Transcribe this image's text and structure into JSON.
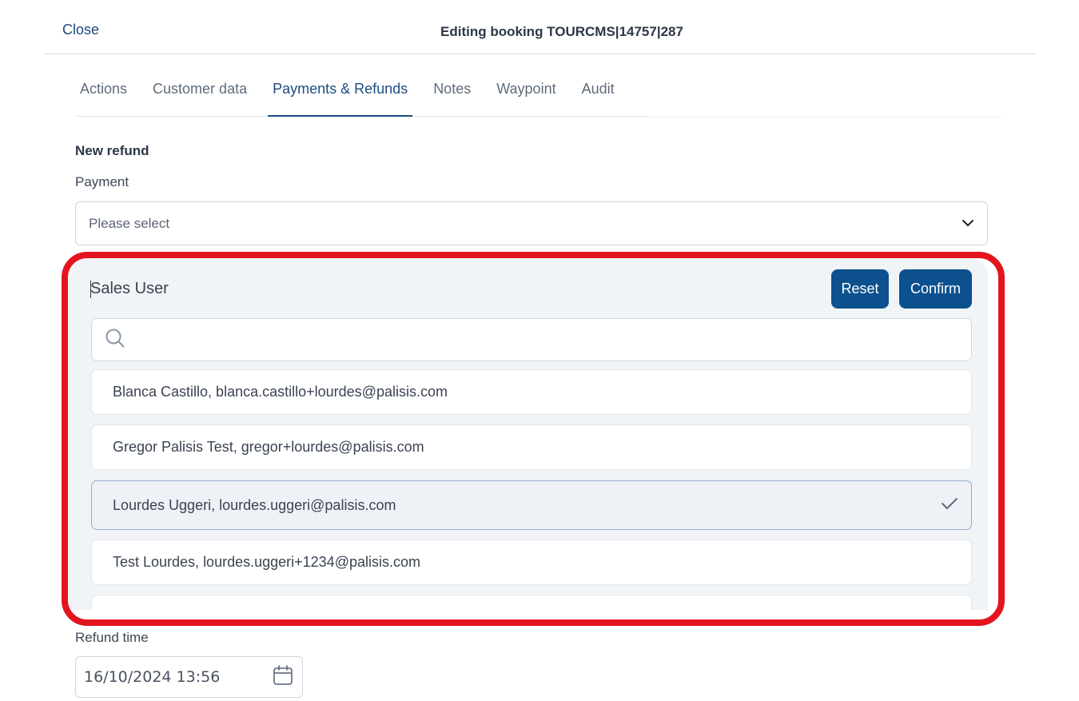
{
  "header": {
    "close_label": "Close",
    "title": "Editing booking TOURCMS|14757|287"
  },
  "tabs": [
    {
      "label": "Actions",
      "active": false
    },
    {
      "label": "Customer data",
      "active": false
    },
    {
      "label": "Payments & Refunds",
      "active": true
    },
    {
      "label": "Notes",
      "active": false
    },
    {
      "label": "Waypoint",
      "active": false
    },
    {
      "label": "Audit",
      "active": false
    }
  ],
  "refund": {
    "section_title": "New refund",
    "payment_label": "Payment",
    "payment_placeholder": "Please select",
    "refund_time_label": "Refund time",
    "refund_time_value": "16/10/2024 13:56"
  },
  "sales_user": {
    "title": "Sales User",
    "reset_label": "Reset",
    "confirm_label": "Confirm",
    "search_value": "",
    "options": [
      {
        "label": "Blanca Castillo, blanca.castillo+lourdes@palisis.com",
        "selected": false
      },
      {
        "label": "Gregor Palisis Test, gregor+lourdes@palisis.com",
        "selected": false
      },
      {
        "label": "Lourdes Uggeri, lourdes.uggeri@palisis.com",
        "selected": true
      },
      {
        "label": "Test Lourdes, lourdes.uggeri+1234@palisis.com",
        "selected": false
      }
    ]
  },
  "colors": {
    "accent": "#0d508e",
    "highlight": "#e3141d"
  },
  "icons": {
    "dropdown": "chevron-down-icon",
    "search": "search-icon",
    "selected": "check-icon",
    "date": "calendar-icon"
  }
}
